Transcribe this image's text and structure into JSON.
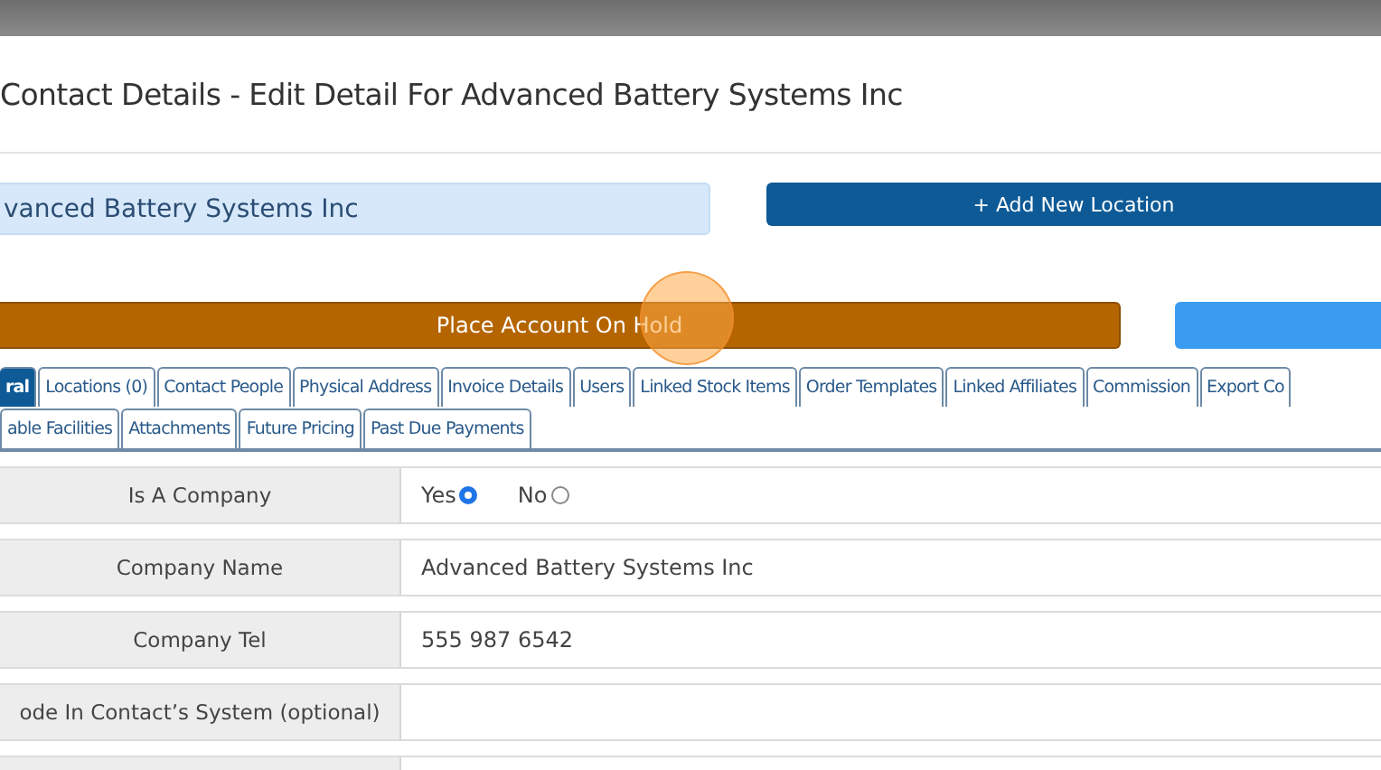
{
  "dialog": {
    "title": "Contact Details - Edit Detail For Advanced Battery Systems Inc"
  },
  "company_field": {
    "value": "vanced Battery Systems Inc"
  },
  "add_location_button": {
    "label": "+ Add New Location"
  },
  "hold_button": {
    "label": "Place Account On Hold"
  },
  "tab_rows": [
    [
      {
        "label": "ral",
        "selected": true
      },
      {
        "label": "Locations (0)",
        "selected": false
      },
      {
        "label": "Contact People",
        "selected": false
      },
      {
        "label": "Physical Address",
        "selected": false
      },
      {
        "label": "Invoice Details",
        "selected": false
      },
      {
        "label": "Users",
        "selected": false
      },
      {
        "label": "Linked Stock Items",
        "selected": false
      },
      {
        "label": "Order Templates",
        "selected": false
      },
      {
        "label": "Linked Affiliates",
        "selected": false
      },
      {
        "label": "Commission",
        "selected": false
      },
      {
        "label": "Export Co",
        "selected": false
      }
    ],
    [
      {
        "label": "able Facilities",
        "selected": false
      },
      {
        "label": "Attachments",
        "selected": false
      },
      {
        "label": "Future Pricing",
        "selected": false
      },
      {
        "label": "Past Due Payments",
        "selected": false
      }
    ]
  ],
  "form_rows": [
    {
      "kind": "radio",
      "label": "Is A Company",
      "options": [
        {
          "label": "Yes",
          "selected": true
        },
        {
          "label": "No",
          "selected": false
        }
      ]
    },
    {
      "kind": "text",
      "label": "Company Name",
      "value": "Advanced Battery Systems Inc"
    },
    {
      "kind": "text",
      "label": "Company Tel",
      "value": "555 987 6542"
    },
    {
      "kind": "text",
      "label": "ode In Contact’s System (optional)",
      "value": ""
    },
    {
      "kind": "text",
      "label": "",
      "value": ""
    }
  ]
}
